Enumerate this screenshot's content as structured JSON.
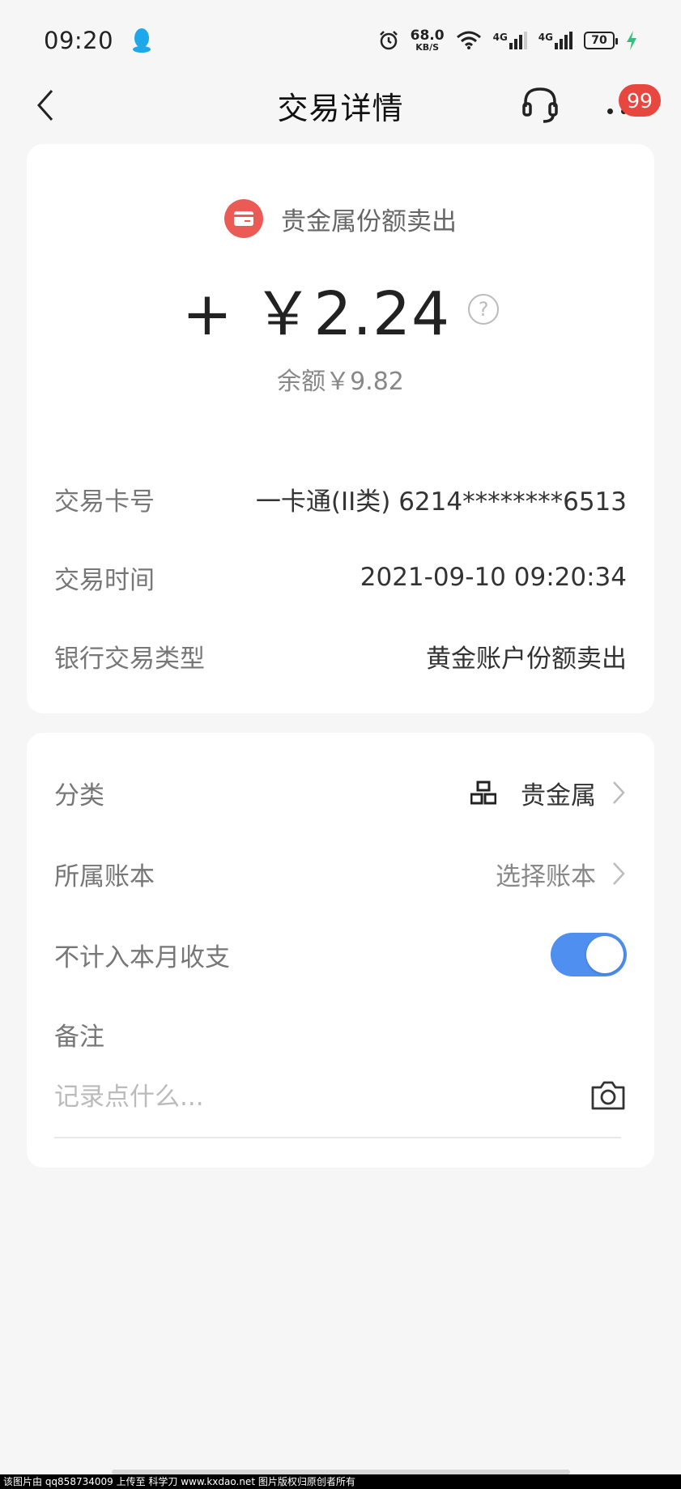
{
  "status_bar": {
    "time": "09:20",
    "net_speed": "68.0",
    "net_speed_unit": "KB/S",
    "signal1": "4G",
    "signal2": "4G",
    "battery": "70"
  },
  "header": {
    "title": "交易详情",
    "badge_count": "99"
  },
  "transaction": {
    "type_label": "贵金属份额卖出",
    "amount": "+ ￥2.24",
    "balance": "余额￥9.82",
    "info": [
      {
        "label": "交易卡号",
        "value": "一卡通(II类) 6214********6513"
      },
      {
        "label": "交易时间",
        "value": "2021-09-10 09:20:34"
      },
      {
        "label": "银行交易类型",
        "value": "黄金账户份额卖出"
      }
    ]
  },
  "settings": {
    "category_label": "分类",
    "category_value": "贵金属",
    "ledger_label": "所属账本",
    "ledger_value": "选择账本",
    "exclude_label": "不计入本月收支",
    "exclude_on": true,
    "note_label": "备注",
    "note_placeholder": "记录点什么..."
  },
  "watermark": "该图片由 qq858734009 上传至 科学刀 www.kxdao.net 图片版权归原创者所有",
  "colors": {
    "accent_blue": "#4e8ff0",
    "badge_red": "#e8473f",
    "icon_red": "#ec5a55"
  }
}
